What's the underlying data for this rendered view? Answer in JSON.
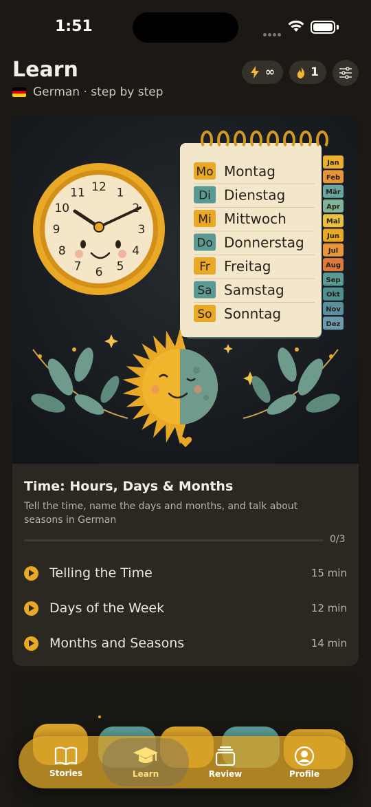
{
  "status": {
    "time": "1:51"
  },
  "header": {
    "title": "Learn",
    "subtitle": "German · step by step",
    "energy": "∞",
    "streak": "1"
  },
  "hero": {
    "clock_numbers": [
      "12",
      "1",
      "2",
      "3",
      "4",
      "5",
      "6",
      "7",
      "8",
      "9",
      "10",
      "11"
    ],
    "days": [
      {
        "abbr": "Mo",
        "name": "Montag",
        "color": "#e9a826"
      },
      {
        "abbr": "Di",
        "name": "Dienstag",
        "color": "#5a9a94"
      },
      {
        "abbr": "Mi",
        "name": "Mittwoch",
        "color": "#e9a826"
      },
      {
        "abbr": "Do",
        "name": "Donnerstag",
        "color": "#5a9a94"
      },
      {
        "abbr": "Fr",
        "name": "Freitag",
        "color": "#e9a826"
      },
      {
        "abbr": "Sa",
        "name": "Samstag",
        "color": "#5a9a94"
      },
      {
        "abbr": "So",
        "name": "Sonntag",
        "color": "#e9a826"
      }
    ],
    "months": [
      {
        "name": "Jan",
        "color": "#e9b030"
      },
      {
        "name": "Feb",
        "color": "#e8953a"
      },
      {
        "name": "Mär",
        "color": "#6aa6a0"
      },
      {
        "name": "Apr",
        "color": "#7fb39a"
      },
      {
        "name": "Mai",
        "color": "#e9c040"
      },
      {
        "name": "Jun",
        "color": "#e9a826"
      },
      {
        "name": "Jul",
        "color": "#e8953a"
      },
      {
        "name": "Aug",
        "color": "#e07a3a"
      },
      {
        "name": "Sep",
        "color": "#5a9a94"
      },
      {
        "name": "Okt",
        "color": "#4f8f90"
      },
      {
        "name": "Nov",
        "color": "#5a8fa0"
      },
      {
        "name": "Dez",
        "color": "#6a9ab0"
      }
    ]
  },
  "lesson_card": {
    "title": "Time: Hours, Days & Months",
    "description": "Tell the time, name the days and months, and talk about seasons in German",
    "progress_text": "0/3",
    "progress_fraction": 0,
    "lessons": [
      {
        "name": "Telling the Time",
        "duration": "15 min"
      },
      {
        "name": "Days of the Week",
        "duration": "12 min"
      },
      {
        "name": "Months and Seasons",
        "duration": "14 min"
      }
    ]
  },
  "tabbar": {
    "tabs": [
      {
        "label": "Stories",
        "icon": "book-icon"
      },
      {
        "label": "Learn",
        "icon": "graduation-cap-icon",
        "active": true
      },
      {
        "label": "Review",
        "icon": "stack-icon"
      },
      {
        "label": "Profile",
        "icon": "person-circle-icon"
      }
    ]
  },
  "colors": {
    "accent": "#e9a826",
    "background": "#1c1915",
    "card": "#2b2822"
  }
}
